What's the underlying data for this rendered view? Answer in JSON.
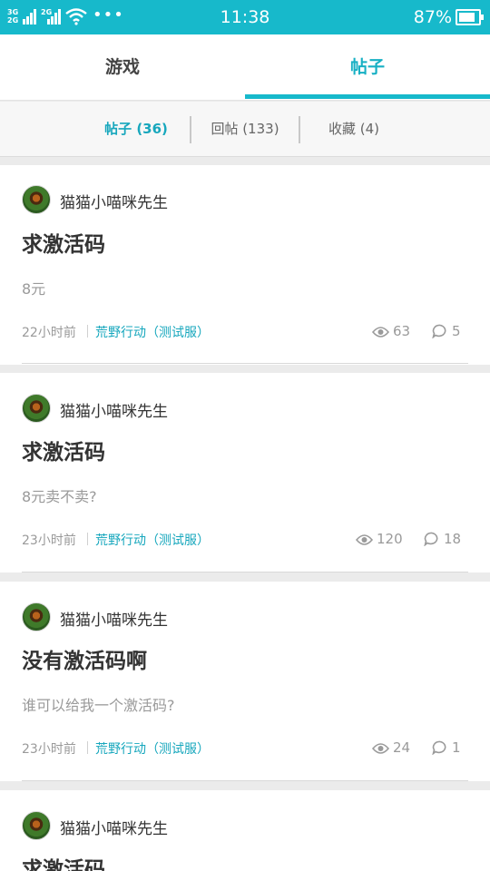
{
  "status_bar": {
    "network_top": "3G",
    "network_bottom": "2G",
    "network2": "2G",
    "dots": "•••",
    "time": "11:38",
    "battery_pct": "87%",
    "battery_level": 0.87
  },
  "tabs": [
    {
      "label": "游戏",
      "active": false
    },
    {
      "label": "帖子",
      "active": true
    }
  ],
  "subtabs": [
    {
      "label": "帖子 (36)",
      "active": true
    },
    {
      "label": "回帖 (133)",
      "active": false
    },
    {
      "label": "收藏 (4)",
      "active": false
    }
  ],
  "posts": [
    {
      "author": "猫猫小喵咪先生",
      "title": "求激活码",
      "body": "8元",
      "time": "22小时前",
      "game": "荒野行动（测试服）",
      "views": "63",
      "comments": "5"
    },
    {
      "author": "猫猫小喵咪先生",
      "title": "求激活码",
      "body": "8元卖不卖?",
      "time": "23小时前",
      "game": "荒野行动（测试服）",
      "views": "120",
      "comments": "18"
    },
    {
      "author": "猫猫小喵咪先生",
      "title": "没有激活码啊",
      "body": "谁可以给我一个激活码?",
      "time": "23小时前",
      "game": "荒野行动（测试服）",
      "views": "24",
      "comments": "1"
    },
    {
      "author": "猫猫小喵咪先生",
      "title": "求激活码"
    }
  ],
  "icons": {
    "views": "eye-icon",
    "comments": "comment-bubble-icon"
  },
  "colors": {
    "accent": "#17b9cb",
    "link": "#17a7bd"
  }
}
